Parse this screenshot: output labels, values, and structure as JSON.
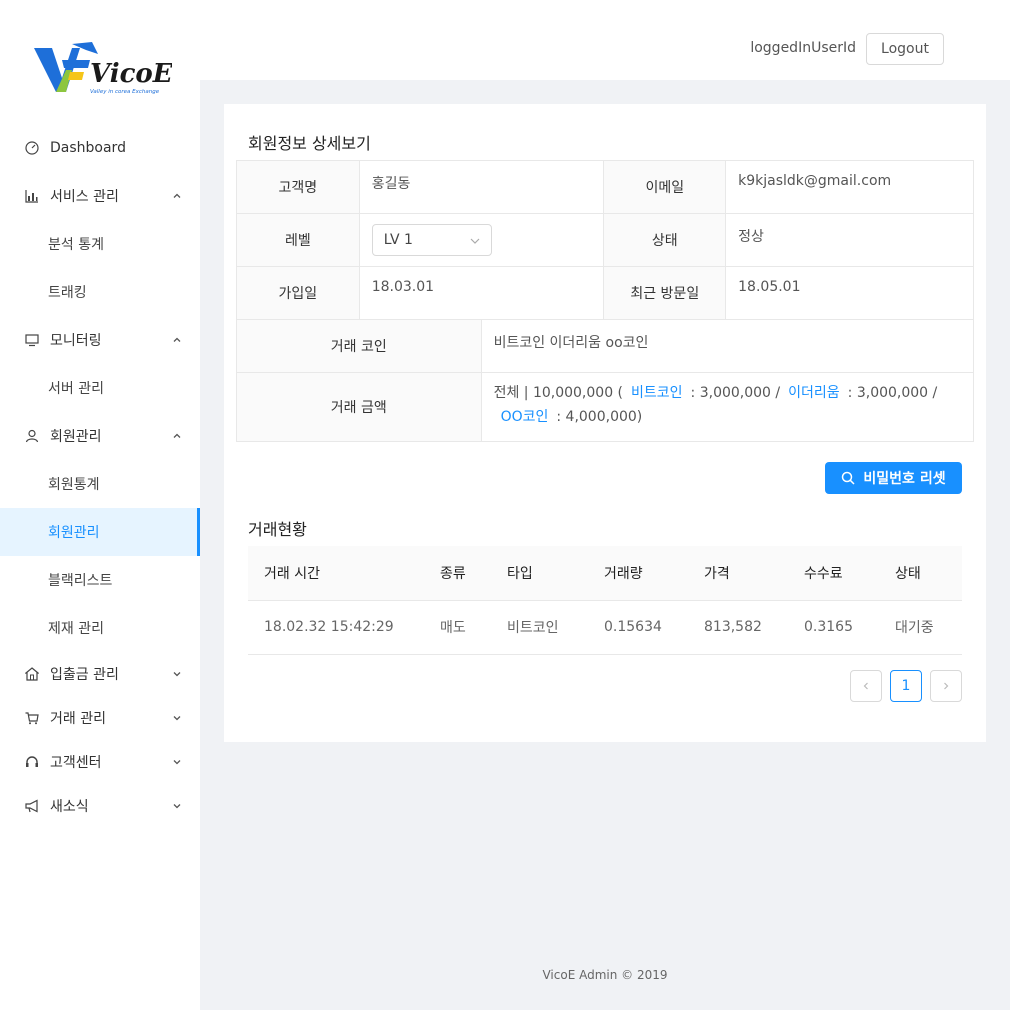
{
  "brand": {
    "logo_text": "VicoE",
    "logo_tagline": "Valley in corea Exchange",
    "colors": {
      "accent": "#1890ff",
      "logo_blue": "#1e6fd9",
      "logo_green": "#8dc63f"
    }
  },
  "header": {
    "user_id": "loggedInUserId",
    "logout_label": "Logout"
  },
  "sidebar": {
    "items": [
      {
        "label": "Dashboard",
        "icon": "dashboard-icon"
      },
      {
        "label": "서비스 관리",
        "icon": "chart-icon",
        "expanded": true
      },
      {
        "label": "분석 통계"
      },
      {
        "label": "트래킹"
      },
      {
        "label": "모니터링",
        "icon": "monitor-icon",
        "expanded": true
      },
      {
        "label": "서버 관리"
      },
      {
        "label": "회원관리",
        "icon": "user-icon",
        "expanded": true
      },
      {
        "label": "회원통계"
      },
      {
        "label": "회원관리",
        "active": true
      },
      {
        "label": "블랙리스트"
      },
      {
        "label": "제재 관리"
      },
      {
        "label": "입출금 관리",
        "icon": "bank-icon",
        "expanded": false
      },
      {
        "label": "거래 관리",
        "icon": "cart-icon",
        "expanded": false
      },
      {
        "label": "고객센터",
        "icon": "headset-icon",
        "expanded": false
      },
      {
        "label": "새소식",
        "icon": "megaphone-icon",
        "expanded": false
      }
    ]
  },
  "member": {
    "section_title": "회원정보 상세보기",
    "name_label": "고객명",
    "name_value": "홍길동",
    "email_label": "이메일",
    "email_value": "k9kjasldk@gmail.com",
    "level_label": "레벨",
    "level_value": "LV 1",
    "status_label": "상태",
    "status_value": "정상",
    "join_label": "가입일",
    "join_value": "18.03.01",
    "visit_label": "최근 방문일",
    "visit_value": "18.05.01",
    "coins_label": "거래 코인",
    "coins_value": "비트코인 이더리움 oo코인",
    "amount_label": "거래 금액",
    "amount_total": "전체 | 10,000,000 (",
    "amount_btc_link": "비트코인",
    "amount_btc_value": ": 3,000,000 /",
    "amount_eth_link": "이더리움",
    "amount_eth_value": ": 3,000,000 /",
    "amount_oo_link": "OO코인",
    "amount_oo_value": ": 4,000,000)"
  },
  "reset_button_label": "비밀번호 리셋",
  "trades": {
    "section_title": "거래현황",
    "columns": [
      "거래 시간",
      "종류",
      "타입",
      "거래량",
      "가격",
      "수수료",
      "상태"
    ],
    "rows": [
      [
        "18.02.32 15:42:29",
        "매도",
        "비트코인",
        "0.15634",
        "813,582",
        "0.3165",
        "대기중"
      ]
    ]
  },
  "pagination": {
    "current_page": "1"
  },
  "footer": "VicoE Admin © 2019"
}
